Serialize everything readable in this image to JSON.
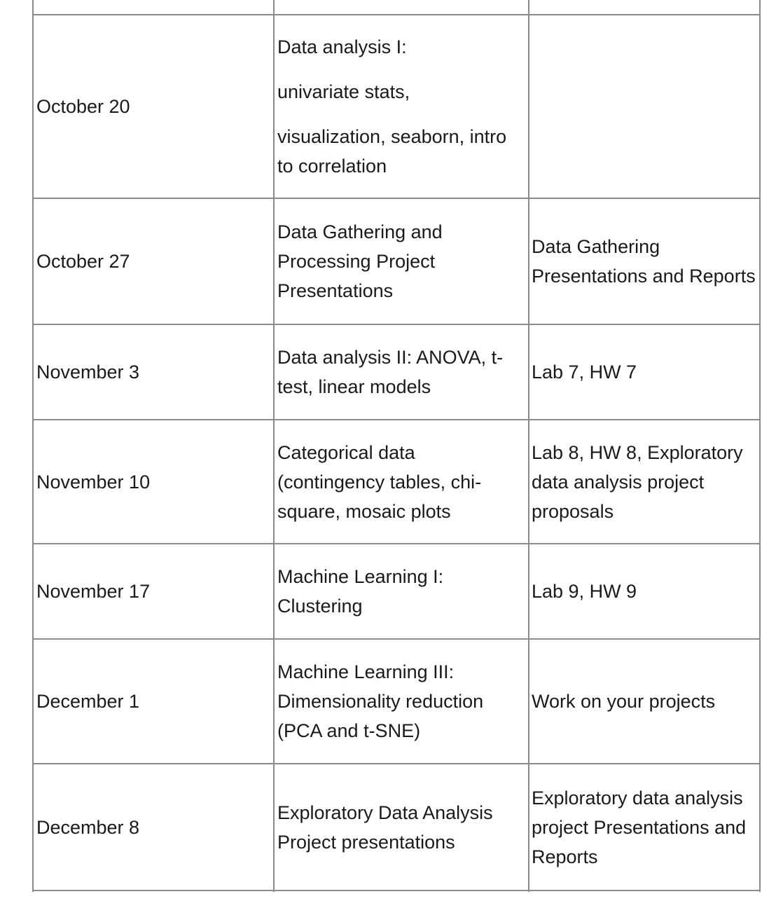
{
  "schedule": {
    "rows": [
      {
        "date": "October 20",
        "topic": [
          "Data analysis I:",
          "univariate stats,",
          "visualization, seaborn, intro to correlation"
        ],
        "assignments": ""
      },
      {
        "date": "October 27",
        "topic": [
          "Data Gathering and Processing Project Presentations"
        ],
        "assignments": "Data Gathering Presentations and Reports"
      },
      {
        "date": "November 3",
        "topic": [
          "Data analysis II: ANOVA, t-test, linear models"
        ],
        "assignments": "Lab 7, HW 7"
      },
      {
        "date": "November 10",
        "topic": [
          "Categorical data (contingency tables, chi-square, mosaic plots"
        ],
        "assignments": "Lab 8, HW 8, Exploratory data analysis project proposals"
      },
      {
        "date": "November 17",
        "topic": [
          "Machine Learning I: Clustering"
        ],
        "assignments": "Lab 9, HW 9"
      },
      {
        "date": "December 1",
        "topic": [
          "Machine Learning III: Dimensionality reduction (PCA and t-SNE)"
        ],
        "assignments": "Work on your projects"
      },
      {
        "date": "December 8",
        "topic": [
          "Exploratory Data Analysis Project presentations"
        ],
        "assignments": "Exploratory data analysis project Presentations and Reports"
      }
    ]
  }
}
